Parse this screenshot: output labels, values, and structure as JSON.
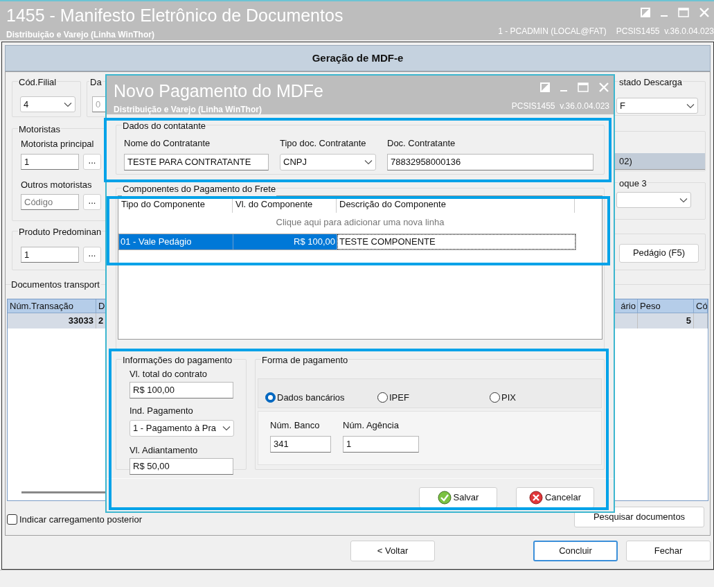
{
  "window": {
    "title": "1455 - Manifesto Eletrônico de Documentos",
    "subtitle": "Distribuição e Varejo (Linha WinThor)",
    "user": "1 - PCADMIN (LOCAL@FAT)",
    "version": "PCSIS1455  v.36.0.04.023"
  },
  "header": "Geração de MDF-e",
  "left": {
    "filial_label": "Cód.Filial",
    "filial_value": "4",
    "da_label": "Da",
    "da_value": "0",
    "motoristas_label": "Motoristas",
    "principal_label": "Motorista principal",
    "principal_value": "1",
    "lookup_button": "...",
    "outros_label": "Outros motoristas",
    "outros_placeholder": "Código",
    "produto_label": "Produto Predominan",
    "produto_value": "1",
    "documentos_label": "Documentos transport"
  },
  "right": {
    "descarga_label": "stado Descarga",
    "descarga_value": "F",
    "band_text": "02)",
    "bloque_label": "oque 3",
    "pedagio_button": "Pedágio (F5)"
  },
  "documents_table": {
    "columns": [
      "Núm.Transação",
      "D",
      "ário",
      "Peso",
      "Có"
    ],
    "rows": [
      {
        "cells": [
          "33033",
          "2",
          "",
          "5",
          ""
        ],
        "selected": true
      }
    ]
  },
  "indicar_checkbox": {
    "label": "Indicar carregamento posterior",
    "checked": false
  },
  "pesquisar_button": "Pesquisar documentos",
  "footer_buttons": [
    {
      "label": "< Voltar",
      "default": false
    },
    {
      "label": "Concluir",
      "default": true
    },
    {
      "label": "Fechar",
      "default": false
    }
  ],
  "dialog": {
    "title": "Novo Pagamento do MDFe",
    "subtitle": "Distribuição e Varejo (Linha WinThor)",
    "version": "PCSIS1455  v.36.0.04.023",
    "contratante": {
      "group": "Dados do contatante",
      "nome_label": "Nome do Contratante",
      "nome_value": "TESTE PARA CONTRATANTE",
      "tipo_label": "Tipo doc. Contratante",
      "tipo_value": "CNPJ",
      "doc_label": "Doc. Contratante",
      "doc_value": "78832958000136"
    },
    "componentes": {
      "group": "Componentes do Pagamento do Frete",
      "columns": [
        "Tipo do Componente",
        "Vl. do Componente",
        "Descrição do Componente"
      ],
      "new_row_hint": "Clique aqui para adicionar uma nova linha",
      "rows": [
        {
          "cells": [
            "01 - Vale Pedágio",
            "R$ 100,00",
            "TESTE COMPONENTE"
          ],
          "selected": true
        }
      ]
    },
    "informacoes": {
      "group": "Informações do pagamento",
      "total_label": "Vl. total do contrato",
      "total_value": "R$ 100,00",
      "ind_label": "Ind. Pagamento",
      "ind_value": "1 - Pagamento à Pra",
      "adiant_label": "Vl. Adiantamento",
      "adiant_value": "R$ 50,00"
    },
    "forma": {
      "group": "Forma de pagamento",
      "options": [
        {
          "label": "Dados bancários",
          "selected": true
        },
        {
          "label": "IPEF",
          "selected": false
        },
        {
          "label": "PIX",
          "selected": false
        }
      ],
      "banco_label": "Núm. Banco",
      "banco_value": "341",
      "agencia_label": "Núm. Agência",
      "agencia_value": "1"
    },
    "buttons": [
      {
        "label": "Salvar",
        "kind": "save"
      },
      {
        "label": "Cancelar",
        "kind": "cancel"
      }
    ]
  }
}
